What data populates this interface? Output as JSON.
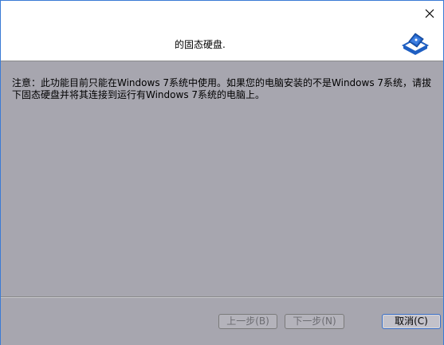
{
  "window": {
    "close_glyph": "✕"
  },
  "header": {
    "title": "的固态硬盘.",
    "logo_icon": "disk-wizard-icon"
  },
  "content": {
    "notice_text": "注意：此功能目前只能在Windows 7系统中使用。如果您的电脑安装的不是Windows 7系统，请拔下固态硬盘并将其连接到运行有Windows 7系统的电脑上。"
  },
  "footer": {
    "back_label": "上一步(B)",
    "next_label": "下一步(N)",
    "cancel_label": "取消(C)"
  },
  "colors": {
    "content_bg": "#a7a6af",
    "accent": "#3a6fc4",
    "logo_blue": "#1f5fc2"
  }
}
